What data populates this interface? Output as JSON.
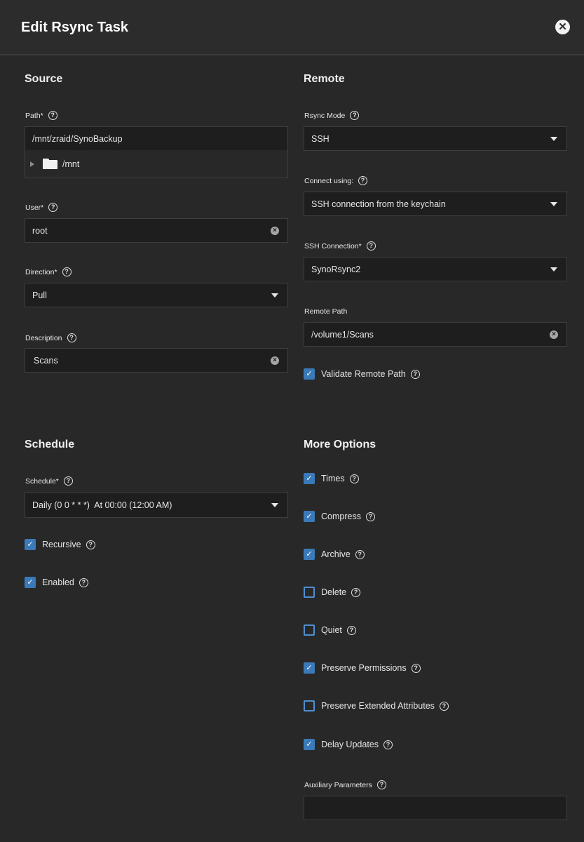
{
  "header": {
    "title": "Edit Rsync Task",
    "close_symbol": "✕"
  },
  "source": {
    "title": "Source",
    "path": {
      "label": "Path",
      "required": "*",
      "value": "/mnt/zraid/SynoBackup",
      "tree_root": "/mnt"
    },
    "user": {
      "label": "User",
      "required": "*",
      "value": "root"
    },
    "direction": {
      "label": "Direction",
      "required": "*",
      "value": "Pull"
    },
    "description": {
      "label": "Description",
      "value": "Scans"
    }
  },
  "remote": {
    "title": "Remote",
    "rsync_mode": {
      "label": "Rsync Mode",
      "value": "SSH"
    },
    "connect_using": {
      "label": "Connect using:",
      "value": "SSH connection from the keychain"
    },
    "ssh_connection": {
      "label": "SSH Connection",
      "required": "*",
      "value": "SynoRsync2"
    },
    "remote_path": {
      "label": "Remote Path",
      "value": "/volume1/Scans"
    },
    "validate_remote_path": {
      "label": "Validate Remote Path",
      "checked": true
    }
  },
  "schedule": {
    "title": "Schedule",
    "schedule": {
      "label": "Schedule",
      "required": "*",
      "value": "Daily (0 0 * * *)  At 00:00 (12:00 AM)"
    },
    "recursive": {
      "label": "Recursive",
      "checked": true
    },
    "enabled": {
      "label": "Enabled",
      "checked": true
    }
  },
  "more_options": {
    "title": "More Options",
    "options": [
      {
        "label": "Times",
        "checked": true
      },
      {
        "label": "Compress",
        "checked": true
      },
      {
        "label": "Archive",
        "checked": true
      },
      {
        "label": "Delete",
        "checked": false
      },
      {
        "label": "Quiet",
        "checked": false
      },
      {
        "label": "Preserve Permissions",
        "checked": true
      },
      {
        "label": "Preserve Extended Attributes",
        "checked": false
      },
      {
        "label": "Delay Updates",
        "checked": true
      }
    ],
    "auxiliary": {
      "label": "Auxiliary Parameters",
      "value": ""
    }
  },
  "icons": {
    "help": "?",
    "clear": "×",
    "check": "✓"
  },
  "colors": {
    "background": "#282829",
    "field": "#1e1e1f",
    "accent": "#3b7ab8"
  }
}
